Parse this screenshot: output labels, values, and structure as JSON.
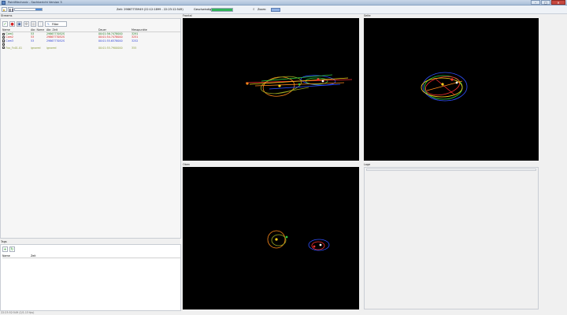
{
  "window": {
    "title": "PointMechanic - Sachbericht Version 3",
    "controls": [
      "–",
      "□",
      "✕"
    ]
  },
  "toolbar": {
    "time_range": "Zeit: 29867735949 (22:12:1899 - 22:23:12:549)",
    "speed_label": "Geschwindigkeit",
    "speed_percent": 100,
    "zoom_label": "Zoom:"
  },
  "streams": {
    "title": "Streams",
    "filter_label": "Filter",
    "columns": [
      "Name",
      "Abr. Name",
      "Abr. Zeit",
      "Dauer",
      "Messpunkte"
    ],
    "rows": [
      {
        "checked": true,
        "name": "Cam1",
        "abbr_name": "53",
        "abbr_time": "2986773052S",
        "duration": "00:01:56.7478000",
        "measurements": "3291",
        "color": "#1f7a1f"
      },
      {
        "checked": true,
        "name": "Cam2",
        "abbr_name": "53",
        "abbr_time": "2986773052S",
        "duration": "00:01:54.7478000",
        "measurements": "3251",
        "color": "#d62020"
      },
      {
        "checked": true,
        "name": "Cam3",
        "abbr_name": "53",
        "abbr_time": "2986773052S",
        "duration": "00:01:55.6578000",
        "measurements": "3252",
        "color": "#2a3fd6"
      },
      {
        "checked": true,
        "name": "",
        "abbr_name": "",
        "abbr_time": "",
        "duration": "",
        "measurements": "",
        "color": "#444444"
      },
      {
        "checked": false,
        "name": "Foo_Fx01.01",
        "abbr_name": "ignored",
        "abbr_time": "ignored",
        "duration": "00:01:55.7900000",
        "measurements": "355",
        "color": "#8a9a3a"
      }
    ]
  },
  "tags": {
    "title": "Tags",
    "columns": [
      "Name",
      "Zeit"
    ]
  },
  "views": {
    "front": "Frontal",
    "side": "Seite",
    "top": "Oben",
    "legend": "Lage"
  },
  "colors": {
    "green": "#2ecc40",
    "red": "#ff3030",
    "blue": "#3050ff",
    "yellow": "#ffd21a",
    "orange": "#ff8a1a",
    "olive": "#9aa820"
  },
  "status_text": "22:23:52:549 (2/1.13 fps)"
}
